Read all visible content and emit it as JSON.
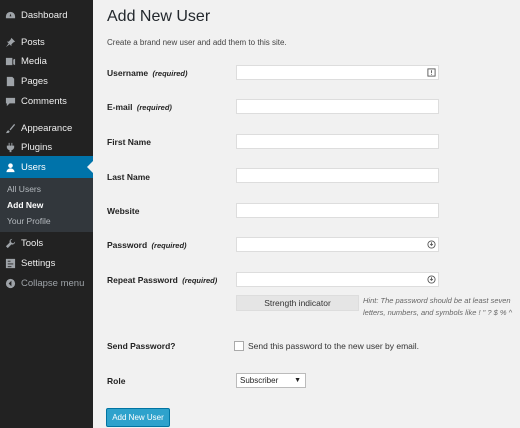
{
  "sidebar": {
    "items": [
      {
        "label": "Dashboard",
        "icon": "dashboard-icon"
      },
      {
        "label": "Posts",
        "icon": "pushpin-icon"
      },
      {
        "label": "Media",
        "icon": "media-icon"
      },
      {
        "label": "Pages",
        "icon": "pages-icon"
      },
      {
        "label": "Comments",
        "icon": "comments-icon"
      },
      {
        "label": "Appearance",
        "icon": "brush-icon"
      },
      {
        "label": "Plugins",
        "icon": "plugin-icon"
      },
      {
        "label": "Users",
        "icon": "user-icon"
      },
      {
        "label": "Tools",
        "icon": "wrench-icon"
      },
      {
        "label": "Settings",
        "icon": "settings-icon"
      },
      {
        "label": "Collapse menu",
        "icon": "collapse-icon"
      }
    ],
    "submenu": [
      "All Users",
      "Add New",
      "Your Profile"
    ]
  },
  "page": {
    "title": "Add New User",
    "description": "Create a brand new user and add them to this site."
  },
  "form": {
    "username_label": "Username",
    "email_label": "E-mail",
    "firstname_label": "First Name",
    "lastname_label": "Last Name",
    "website_label": "Website",
    "password_label": "Password",
    "repeat_password_label": "Repeat Password",
    "required_text": "(required)",
    "strength_label": "Strength indicator",
    "hint_line1": "Hint: The password should be at least seven",
    "hint_line2": "letters, numbers, and symbols like ! \" ? $ % ^",
    "send_password_label": "Send Password?",
    "send_password_text": "Send this password to the new user by email.",
    "role_label": "Role",
    "role_value": "Subscriber",
    "submit_label": "Add New User"
  },
  "colors": {
    "sidebar_bg": "#222222",
    "active": "#0073aa",
    "button": "#2ea2cc"
  }
}
